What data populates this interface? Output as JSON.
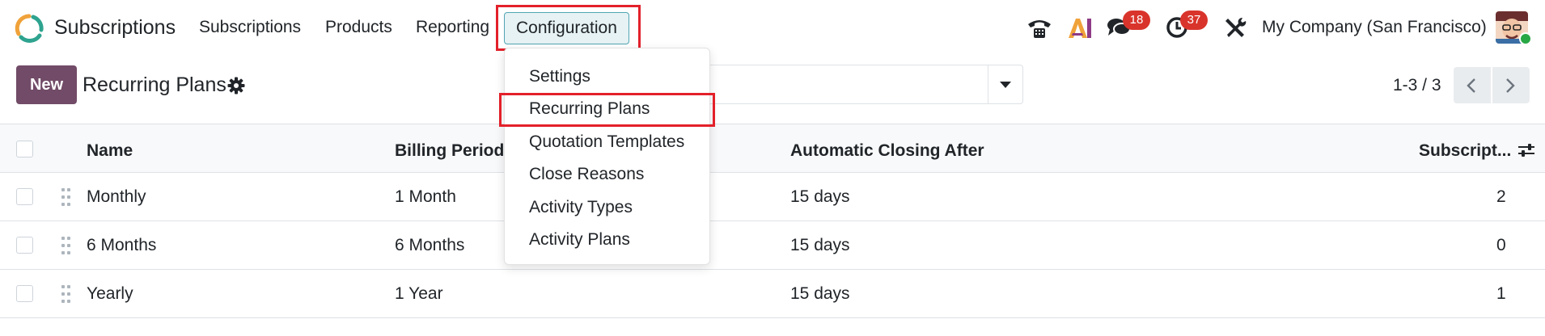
{
  "navbar": {
    "app_name": "Subscriptions",
    "menus": [
      "Subscriptions",
      "Products",
      "Reporting"
    ],
    "active_menu": "Configuration",
    "messages_badge": "18",
    "activities_badge": "37",
    "company": "My Company (San Francisco)"
  },
  "control": {
    "new_label": "New",
    "title": "Recurring Plans",
    "pager": "1-3 / 3"
  },
  "dropdown": {
    "items": [
      "Settings",
      "Recurring Plans",
      "Quotation Templates",
      "Close Reasons",
      "Activity Types",
      "Activity Plans"
    ],
    "highlighted": "Recurring Plans"
  },
  "table": {
    "columns": [
      "Name",
      "Billing Period",
      "Automatic Closing After",
      "Subscript..."
    ],
    "rows": [
      {
        "name": "Monthly",
        "billing": "1 Month",
        "closing": "15 days",
        "subs": "2"
      },
      {
        "name": "6 Months",
        "billing": "6 Months",
        "closing": "15 days",
        "subs": "0"
      },
      {
        "name": "Yearly",
        "billing": "1 Year",
        "closing": "15 days",
        "subs": "1"
      }
    ]
  },
  "colors": {
    "primary": "#714b67",
    "active_menu_bg": "#e6f2f4",
    "badge": "#d9342b",
    "highlight": "#e3202a"
  }
}
